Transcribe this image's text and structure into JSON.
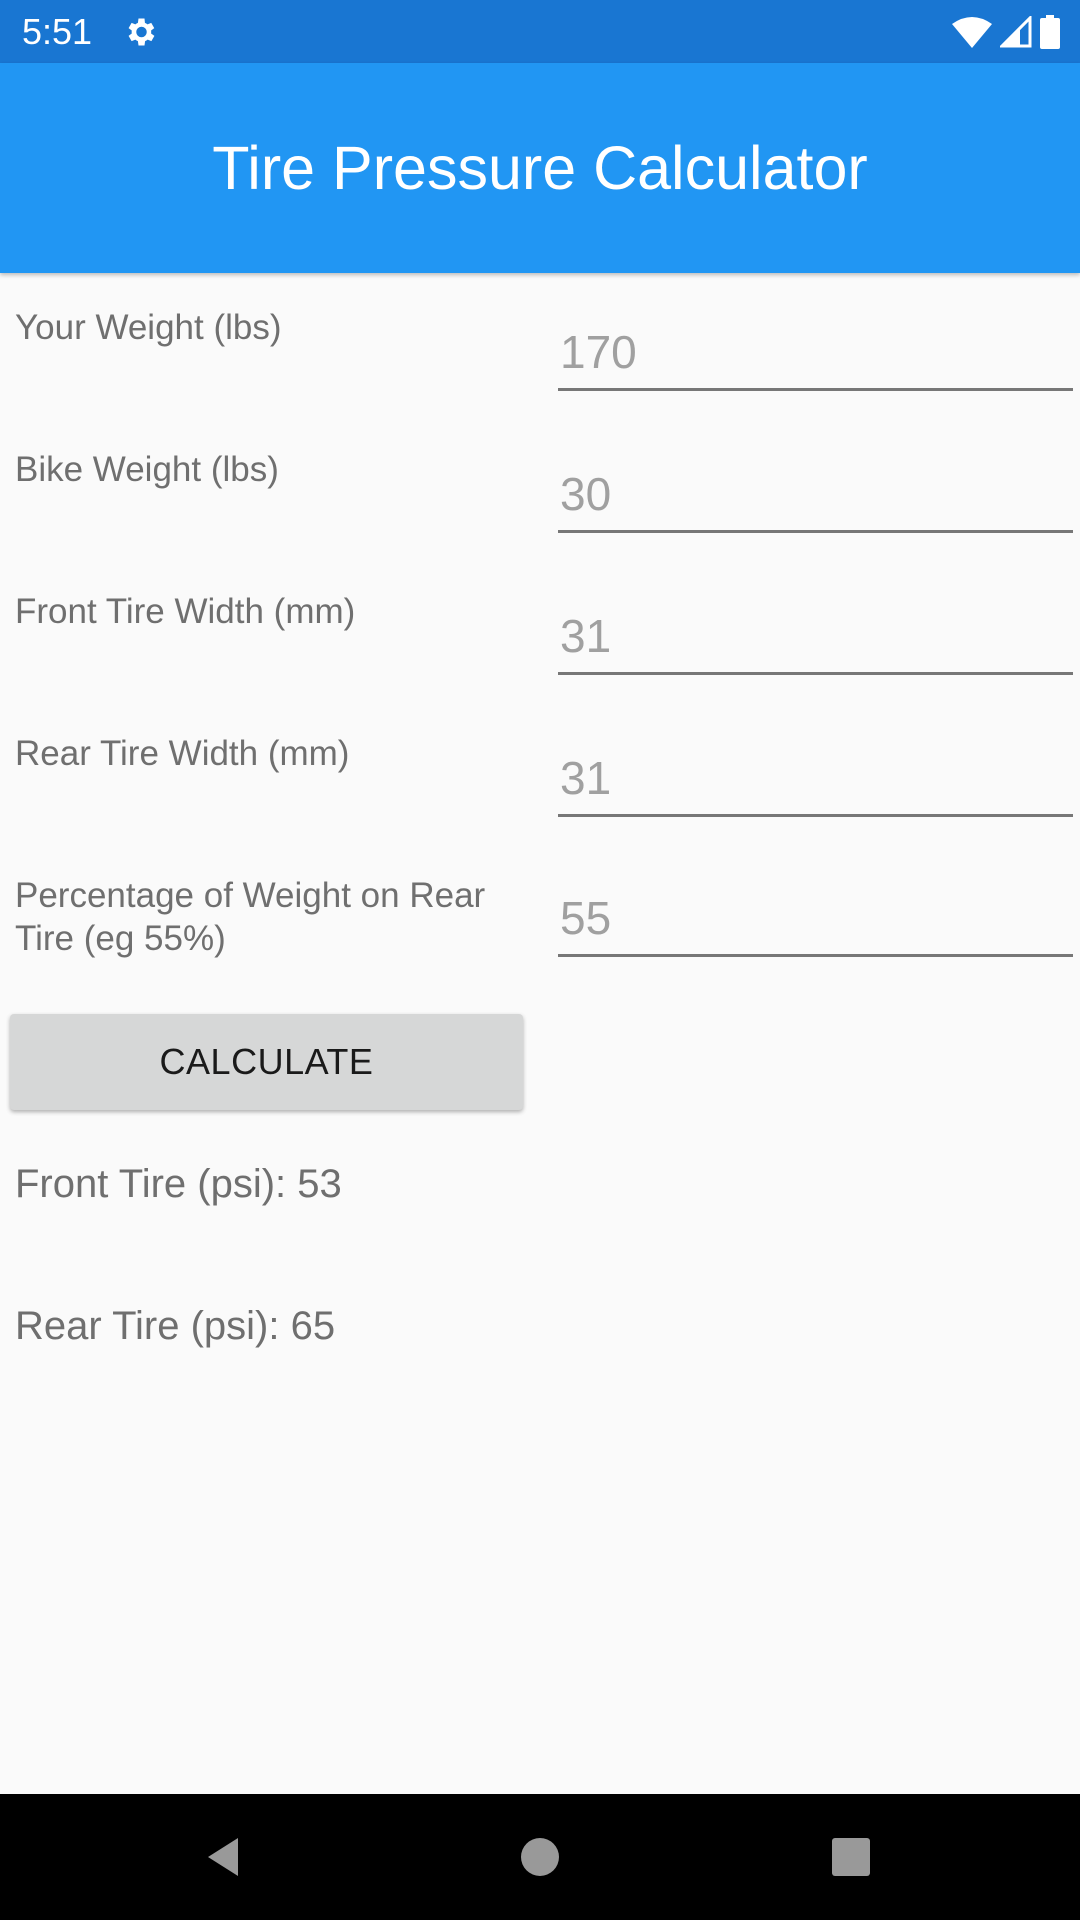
{
  "status_bar": {
    "time": "5:51",
    "icons": [
      "gear-icon",
      "wifi-icon",
      "cell-signal-icon",
      "battery-icon"
    ]
  },
  "app_bar": {
    "title": "Tire Pressure Calculator"
  },
  "form": {
    "fields": [
      {
        "label": "Your Weight (lbs)",
        "placeholder": "170",
        "value": ""
      },
      {
        "label": "Bike Weight (lbs)",
        "placeholder": "30",
        "value": ""
      },
      {
        "label": "Front Tire Width (mm)",
        "placeholder": "31",
        "value": ""
      },
      {
        "label": "Rear Tire Width (mm)",
        "placeholder": "31",
        "value": ""
      },
      {
        "label": "Percentage of Weight on Rear Tire (eg 55%)",
        "placeholder": "55",
        "value": ""
      }
    ],
    "calculate_label": "CALCULATE"
  },
  "results": {
    "front": "Front Tire (psi): 53",
    "rear": "Rear Tire (psi): 65"
  },
  "nav_bar": {
    "buttons": [
      "back",
      "home",
      "recents"
    ]
  },
  "colors": {
    "status_bar": "#1976d2",
    "app_bar": "#2196f3",
    "background": "#fafafa",
    "button": "#d6d7d7"
  }
}
